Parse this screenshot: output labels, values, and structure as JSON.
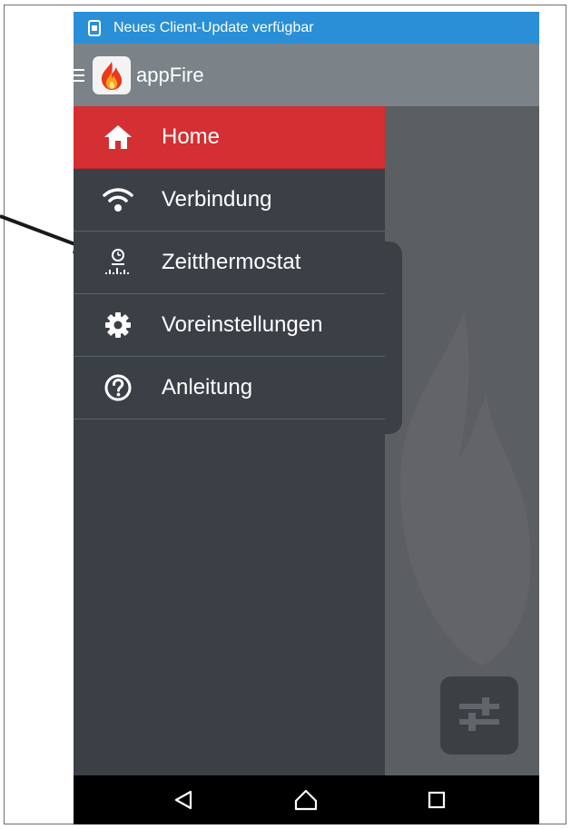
{
  "notification": {
    "text": "Neues Client-Update verfügbar",
    "icon": "phone-update-icon"
  },
  "appbar": {
    "title": "appFire",
    "menu_icon": "hamburger-icon",
    "logo_icon": "flame-logo-icon"
  },
  "drawer": {
    "items": [
      {
        "label": "Home",
        "icon": "home-icon",
        "active": true
      },
      {
        "label": "Verbindung",
        "icon": "wifi-icon",
        "active": false
      },
      {
        "label": "Zeitthermostat",
        "icon": "timer-thermostat-icon",
        "active": false
      },
      {
        "label": "Voreinstellungen",
        "icon": "gear-icon",
        "active": false
      },
      {
        "label": "Anleitung",
        "icon": "help-icon",
        "active": false
      }
    ]
  },
  "fab": {
    "icon": "sliders-icon"
  },
  "navbar": {
    "back_icon": "back-icon",
    "home_icon": "home-nav-icon",
    "recents_icon": "recents-icon"
  },
  "colors": {
    "status_bar": "#2a8fd6",
    "app_bar": "#7b8388",
    "drawer_bg": "#3b4047",
    "active_item": "#d42f32",
    "content_bg": "#5c5f61"
  }
}
